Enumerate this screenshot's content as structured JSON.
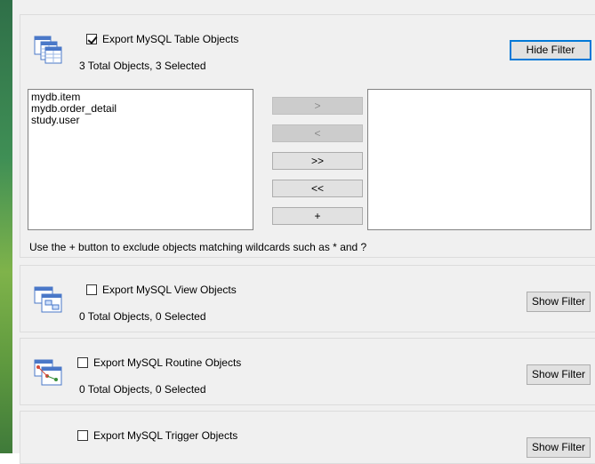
{
  "sections": {
    "table": {
      "checkbox_label": "Export MySQL Table Objects",
      "checked": true,
      "summary": "3 Total Objects, 3 Selected",
      "filter_button": "Hide Filter",
      "available_items": [
        "mydb.item",
        "mydb.order_detail",
        "study.user"
      ],
      "selected_items": [],
      "move_buttons": {
        "add": ">",
        "remove": "<",
        "add_all": ">>",
        "remove_all": "<<",
        "wildcard": "+"
      },
      "hint": "Use the + button to exclude objects matching wildcards such as * and ?"
    },
    "view": {
      "checkbox_label": "Export MySQL View Objects",
      "checked": false,
      "summary": "0 Total Objects, 0 Selected",
      "filter_button": "Show Filter"
    },
    "routine": {
      "checkbox_label": "Export MySQL Routine Objects",
      "checked": false,
      "summary": "0 Total Objects, 0 Selected",
      "filter_button": "Show Filter"
    },
    "trigger": {
      "checkbox_label": "Export MySQL Trigger Objects",
      "checked": false,
      "filter_button": "Show Filter"
    }
  },
  "colors": {
    "accent_border": "#0078d7",
    "panel_bg": "#f0f0f0",
    "icon_blue": "#3a6fc4"
  },
  "icons": {
    "table": "table-objects-icon",
    "view": "view-objects-icon",
    "routine": "routine-objects-icon"
  }
}
